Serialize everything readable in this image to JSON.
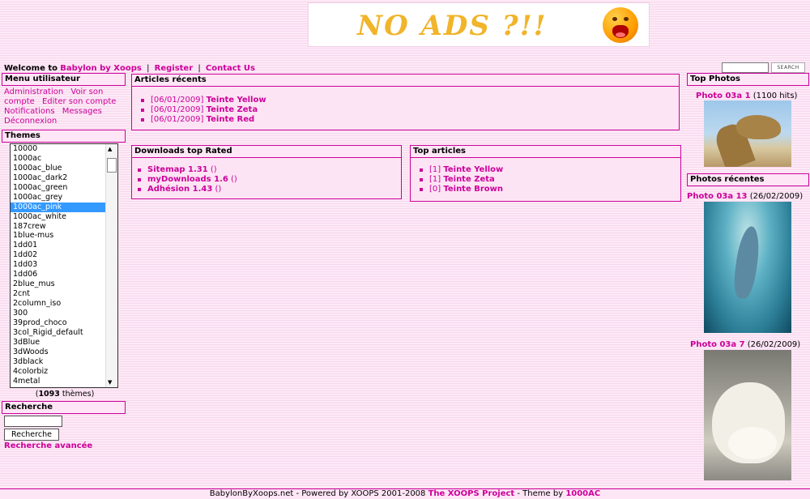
{
  "banner": {
    "text": "NO ADS ?!!"
  },
  "welcome": {
    "prefix": "Welcome to",
    "site": "Babylon by Xoops",
    "register": "Register",
    "contact": "Contact Us"
  },
  "topsearch": {
    "button": "SEARCH"
  },
  "user_menu": {
    "title": "Menu utilisateur",
    "items": [
      "Administration",
      "Voir son compte",
      "Editer son compte",
      "Notifications",
      "Messages",
      "Déconnexion"
    ]
  },
  "themes": {
    "title": "Themes",
    "options": [
      "10000",
      "1000ac",
      "1000ac_blue",
      "1000ac_dark2",
      "1000ac_green",
      "1000ac_grey",
      "1000ac_pink",
      "1000ac_white",
      "187crew",
      "1blue-mus",
      "1dd01",
      "1dd02",
      "1dd03",
      "1dd06",
      "2blue_mus",
      "2cnt",
      "2column_iso",
      "300",
      "39prod_choco",
      "3col_Rigid_default",
      "3dBlue",
      "3dWoods",
      "3dblack",
      "4colorbiz",
      "4metal"
    ],
    "selected_index": 6,
    "count": "1093",
    "count_suffix": "thèmes"
  },
  "search": {
    "title": "Recherche",
    "button": "Recherche",
    "advanced": "Recherche avancée"
  },
  "articles_recents": {
    "title": "Articles récents",
    "items": [
      {
        "date": "[06/01/2009]",
        "title": "Teinte Yellow"
      },
      {
        "date": "[06/01/2009]",
        "title": "Teinte Zeta"
      },
      {
        "date": "[06/01/2009]",
        "title": "Teinte Red"
      }
    ]
  },
  "downloads": {
    "title": "Downloads top Rated",
    "items": [
      {
        "name": "Sitemap 1.31",
        "extra": "()"
      },
      {
        "name": "myDownloads 1.6",
        "extra": "()"
      },
      {
        "name": "Adhésion 1.43",
        "extra": "()"
      }
    ]
  },
  "top_articles": {
    "title": "Top articles",
    "items": [
      {
        "count": "[1]",
        "title": "Teinte Yellow"
      },
      {
        "count": "[1]",
        "title": "Teinte Zeta"
      },
      {
        "count": "[0]",
        "title": "Teinte Brown"
      }
    ]
  },
  "top_photos": {
    "title": "Top Photos",
    "photo": {
      "name": "Photo 03a 1",
      "info": "(1100 hits)"
    }
  },
  "recent_photos": {
    "title": "Photos récentes",
    "photos": [
      {
        "name": "Photo 03a 13",
        "info": "(26/02/2009)"
      },
      {
        "name": "Photo 03a 7",
        "info": "(26/02/2009)"
      }
    ]
  },
  "footer": {
    "site": "BabylonByXoops.net",
    "powered": " - Powered by XOOPS 2001-2008 ",
    "project": "The XOOPS Project",
    "theme_by": " - Theme by ",
    "author": "1000AC"
  },
  "colors": {
    "accent": "#cc0099",
    "background": "#fbe3f3",
    "selected": "#3399ff"
  }
}
